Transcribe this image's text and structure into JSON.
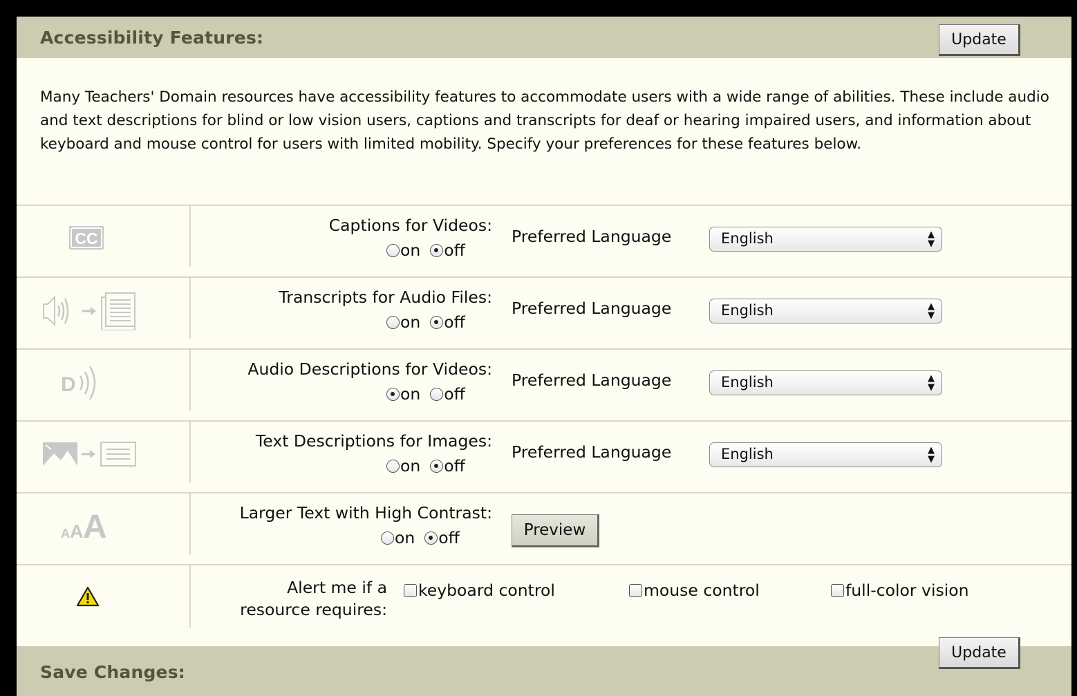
{
  "header": {
    "title": "Accessibility Features:",
    "update_label": "Update"
  },
  "intro_text": "Many Teachers' Domain resources have accessibility features to accommodate users with a wide range of abilities. These include audio and text descriptions for blind or low vision users, captions and transcripts for deaf or hearing impaired users, and information about keyboard and mouse control for users with limited mobility. Specify your preferences for these features below.",
  "features": [
    {
      "label": "Captions for Videos:",
      "on_label": "on",
      "off_label": "off",
      "selected": "off",
      "pref_label": "Preferred Language",
      "language": "English",
      "icon": "closed-captions-icon"
    },
    {
      "label": "Transcripts for Audio Files:",
      "on_label": "on",
      "off_label": "off",
      "selected": "off",
      "pref_label": "Preferred Language",
      "language": "English",
      "icon": "audio-transcript-icon"
    },
    {
      "label": "Audio Descriptions for Videos:",
      "on_label": "on",
      "off_label": "off",
      "selected": "on",
      "pref_label": "Preferred Language",
      "language": "English",
      "icon": "audio-description-icon"
    },
    {
      "label": "Text Descriptions for Images:",
      "on_label": "on",
      "off_label": "off",
      "selected": "off",
      "pref_label": "Preferred Language",
      "language": "English",
      "icon": "image-description-icon"
    }
  ],
  "large_text": {
    "label": "Larger Text with High Contrast:",
    "on_label": "on",
    "off_label": "off",
    "selected": "off",
    "preview_label": "Preview",
    "icon": "text-size-icon"
  },
  "alert": {
    "label_line1": "Alert me if a",
    "label_line2": "resource requires:",
    "options": [
      "keyboard control",
      "mouse control",
      "full-color vision"
    ],
    "icon": "warning-icon"
  },
  "footer": {
    "title": "Save Changes:",
    "update_label": "Update"
  }
}
